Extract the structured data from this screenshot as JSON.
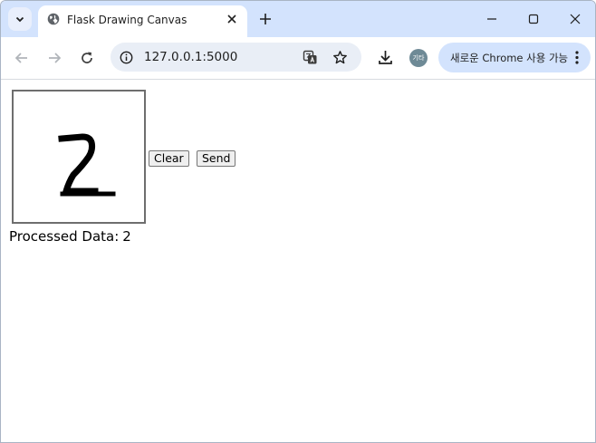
{
  "browser": {
    "tab": {
      "title": "Flask Drawing Canvas"
    },
    "omnibox": {
      "url": "127.0.0.1:5000"
    },
    "profile": {
      "avatar_text": "기타"
    },
    "chrome_pill": {
      "label": "새로운 Chrome 사용 가능"
    },
    "icons": {
      "tab_search": "chevron-down-icon",
      "favicon": "globe-icon",
      "tab_close": "close-icon",
      "new_tab": "plus-icon",
      "minimize": "minimize-icon",
      "maximize": "maximize-icon",
      "close_window": "close-icon",
      "back": "arrow-left-icon",
      "forward": "arrow-right-icon",
      "reload": "reload-icon",
      "site_info": "info-icon",
      "translate": "translate-icon",
      "bookmark": "star-icon",
      "download": "download-icon",
      "menu": "kebab-icon"
    },
    "colors": {
      "tabstrip": "#d3e3fd",
      "omnibox": "#e9eef6",
      "pill": "#d3e3fd"
    }
  },
  "page": {
    "canvas": {
      "drawn_digit": "2"
    },
    "buttons": {
      "clear": "Clear",
      "send": "Send"
    },
    "result": {
      "label": "Processed Data:",
      "value": "2"
    }
  }
}
